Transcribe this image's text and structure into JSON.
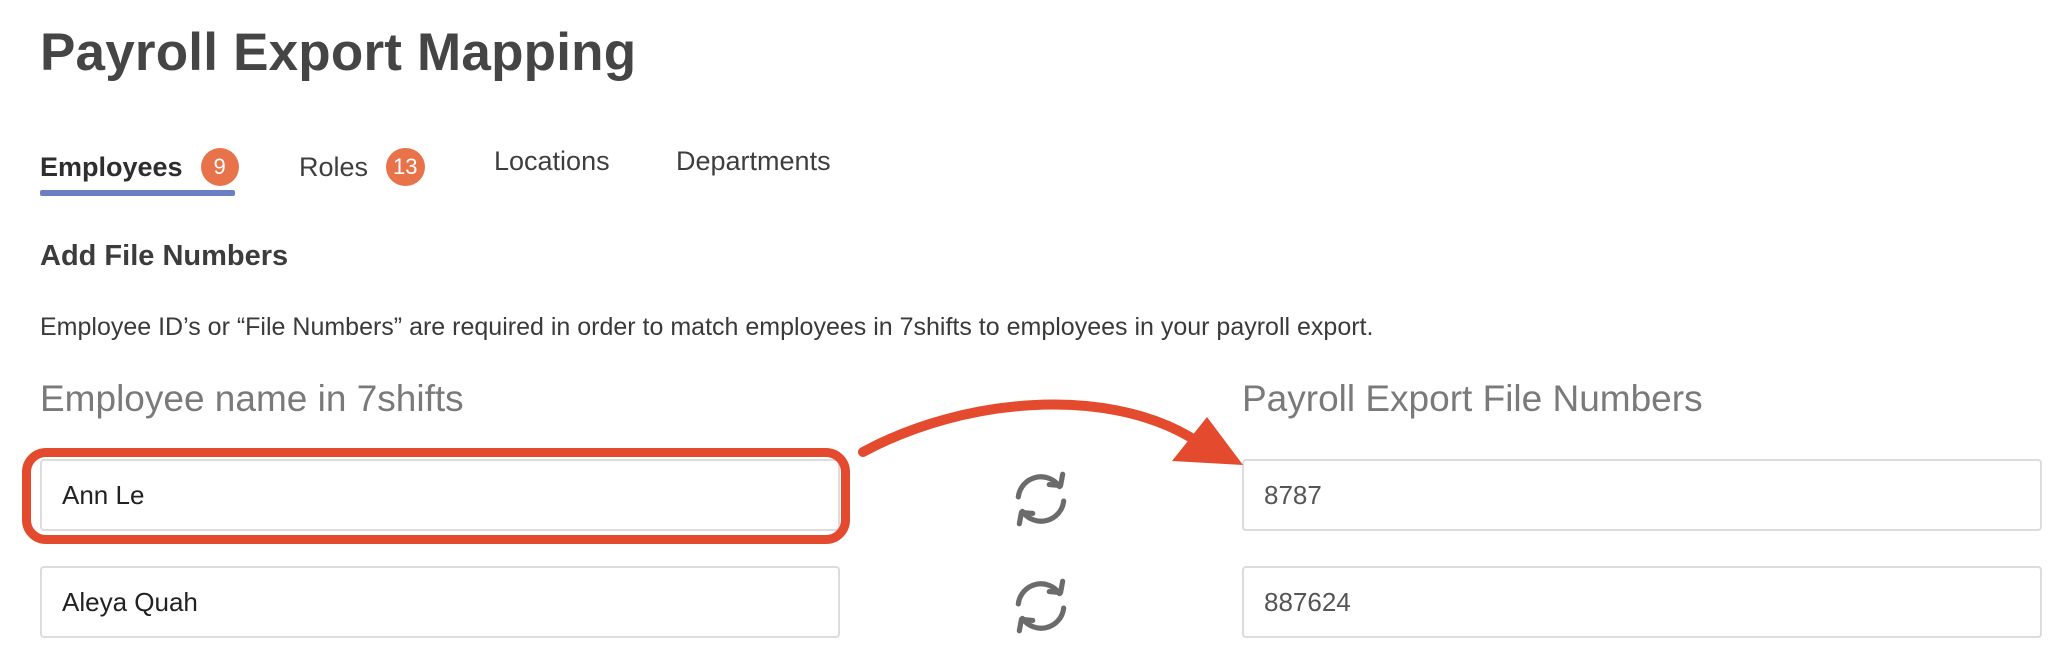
{
  "page": {
    "title": "Payroll Export Mapping"
  },
  "tabs": [
    {
      "label": "Employees",
      "badge": "9",
      "active": true
    },
    {
      "label": "Roles",
      "badge": "13",
      "active": false
    },
    {
      "label": "Locations",
      "badge": null,
      "active": false
    },
    {
      "label": "Departments",
      "badge": null,
      "active": false
    }
  ],
  "section": {
    "heading": "Add File Numbers",
    "description": "Employee ID’s or “File Numbers” are required in order to match employees in 7shifts to employees in your payroll export."
  },
  "columns": {
    "left": "Employee name in 7shifts",
    "right": "Payroll Export File Numbers"
  },
  "rows": [
    {
      "employee_name": "Ann Le",
      "file_number": "8787",
      "highlighted": true
    },
    {
      "employee_name": "Aleya Quah",
      "file_number": "887624",
      "highlighted": false
    }
  ],
  "icons": {
    "row_action": "sync-icon"
  },
  "colors": {
    "accent_tab": "#6c7fc4",
    "badge": "#e8734a",
    "annotation": "#e44a2d"
  }
}
